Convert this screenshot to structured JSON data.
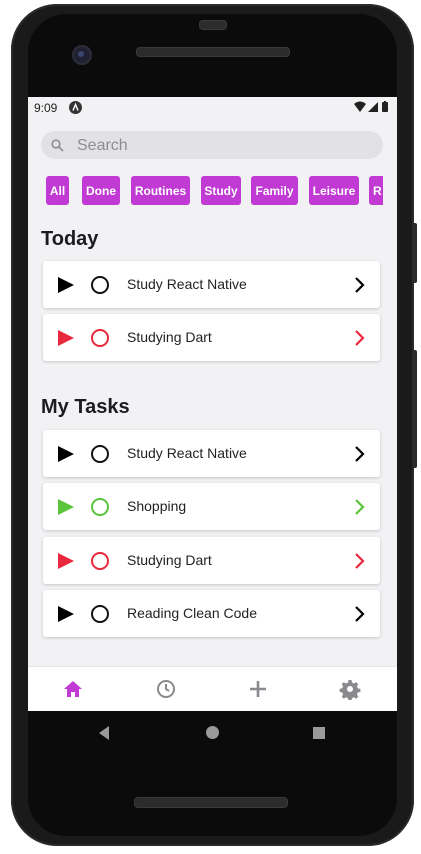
{
  "status_bar": {
    "time": "9:09"
  },
  "search": {
    "placeholder": "Search"
  },
  "filters": [
    "All",
    "Done",
    "Routines",
    "Study",
    "Family",
    "Leisure",
    "R"
  ],
  "today": {
    "title": "Today",
    "tasks": [
      {
        "label": "Study React Native",
        "color": "#000000"
      },
      {
        "label": "Studying Dart",
        "color": "#e8283c"
      }
    ]
  },
  "my_tasks": {
    "title": "My Tasks",
    "tasks": [
      {
        "label": "Study React Native",
        "color": "#000000"
      },
      {
        "label": "Shopping",
        "color": "#5ac43a"
      },
      {
        "label": "Studying Dart",
        "color": "#e8283c"
      },
      {
        "label": "Reading Clean Code",
        "color": "#000000"
      }
    ]
  },
  "tab_bar": {
    "items": [
      "home-icon",
      "clock-icon",
      "plus-icon",
      "gear-icon"
    ],
    "active_color": "#c13ad4",
    "inactive_color": "#8a8a8e"
  },
  "accent_color": "#c13ad4"
}
